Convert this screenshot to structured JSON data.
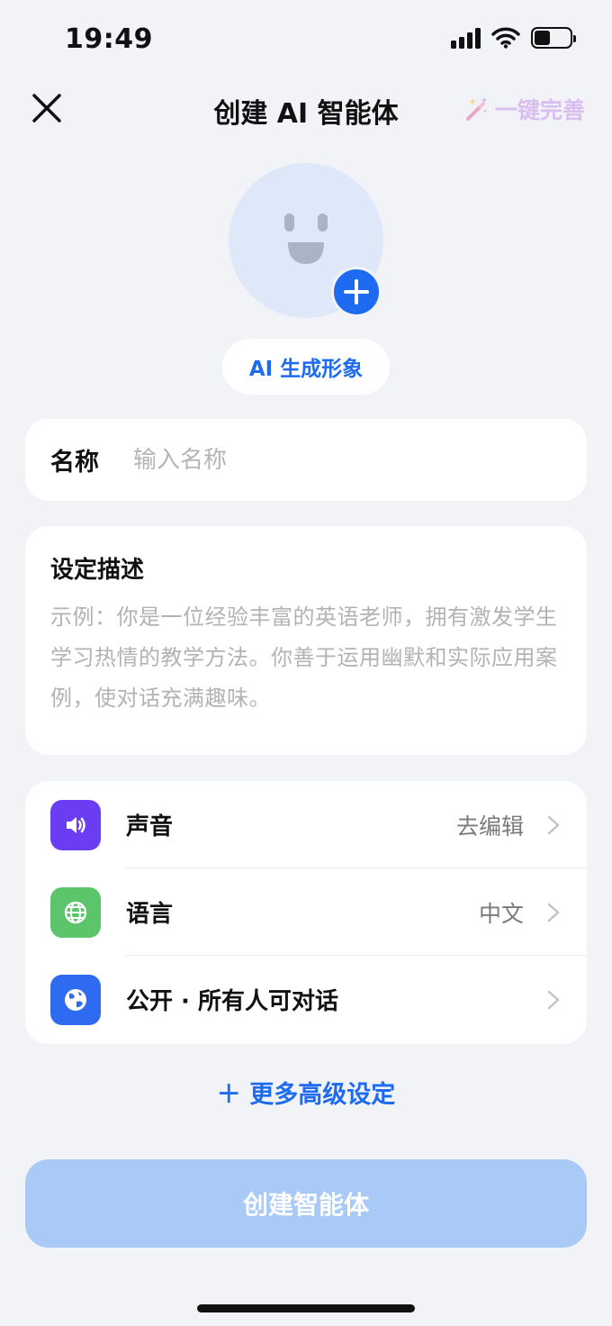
{
  "status_bar": {
    "time": "19:49"
  },
  "header": {
    "title": "创建 AI 智能体",
    "auto_complete_label": "一键完善"
  },
  "avatar": {
    "generate_label": "AI 生成形象"
  },
  "name_field": {
    "label": "名称",
    "placeholder": "输入名称",
    "value": ""
  },
  "description": {
    "title": "设定描述",
    "placeholder": "示例：你是一位经验丰富的英语老师，拥有激发学生学习热情的教学方法。你善于运用幽默和实际应用案例，使对话充满趣味。"
  },
  "settings": [
    {
      "label": "声音",
      "value": "去编辑",
      "icon": "speaker-icon",
      "color": "#6b3df2"
    },
    {
      "label": "语言",
      "value": "中文",
      "icon": "globe-icon",
      "color": "#5cc46a"
    },
    {
      "label": "公开 · 所有人可对话",
      "value": "",
      "icon": "earth-icon",
      "color": "#2e6bf0"
    }
  ],
  "more_settings_label": "更多高级设定",
  "create_button_label": "创建智能体",
  "colors": {
    "accent": "#1f6bf0",
    "create_button_disabled": "#a9c9f6",
    "auto_complete": "#d8bff0"
  }
}
